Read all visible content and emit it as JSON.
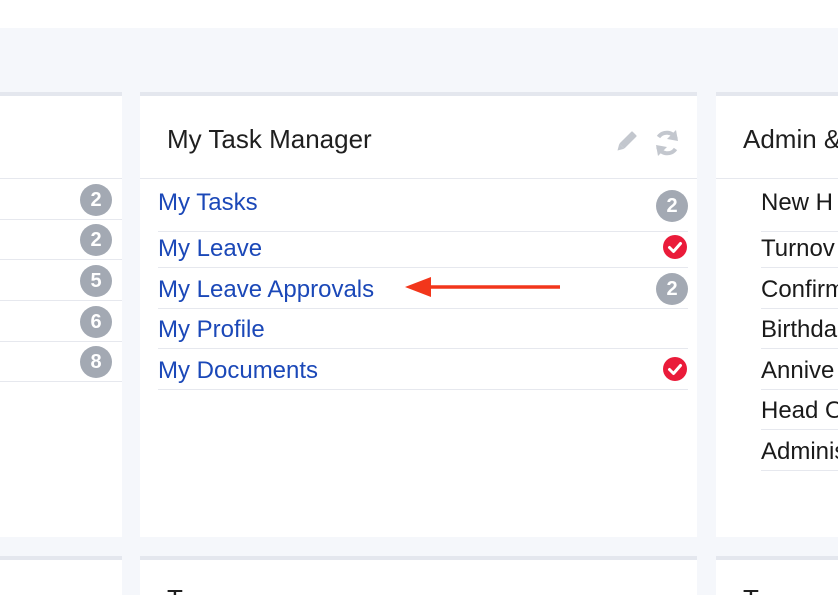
{
  "task_manager": {
    "title": "My Task Manager",
    "items": [
      {
        "label": "My Tasks",
        "badge": "2"
      },
      {
        "label": "My Leave",
        "status": "check-icon"
      },
      {
        "label": "My Leave Approvals",
        "badge": "2"
      },
      {
        "label": "My Profile"
      },
      {
        "label": "My Documents",
        "status": "check-icon"
      }
    ],
    "icons": [
      "pencil-icon",
      "refresh-icon"
    ]
  },
  "left_panel": {
    "badges": [
      "2",
      "2",
      "5",
      "6",
      "8"
    ]
  },
  "admin_panel": {
    "title": "Admin &",
    "items": [
      "New H",
      "Turnov",
      "Confirm",
      "Birthda",
      "Annive",
      "Head O",
      "Adminis"
    ]
  },
  "bottom_cards": {
    "center_title": "T",
    "right_title": "T"
  },
  "annotation": {
    "arrow_color": "#f2361b"
  },
  "colors": {
    "link": "#1b48b8",
    "badge": "#a3a9b3",
    "check": "#ea1b3a",
    "page_bg": "#f5f7fb"
  }
}
